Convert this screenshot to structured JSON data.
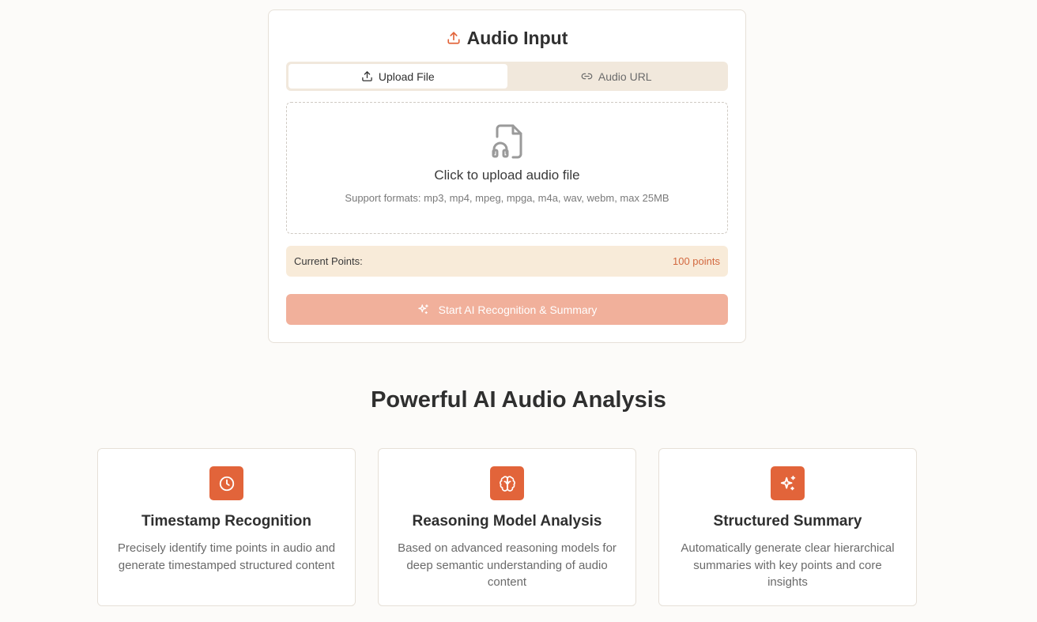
{
  "audio_input": {
    "title": "Audio Input",
    "tabs": [
      {
        "label": "Upload File",
        "active": true,
        "icon": "upload-icon"
      },
      {
        "label": "Audio URL",
        "active": false,
        "icon": "link-icon"
      }
    ],
    "dropzone": {
      "icon": "audio-file-icon",
      "title": "Click to upload audio file",
      "subtitle": "Support formats: mp3, mp4, mpeg, mpga, m4a, wav, webm, max 25MB"
    },
    "points": {
      "label": "Current Points:",
      "value": "100 points"
    },
    "start_button": {
      "label": "Start AI Recognition & Summary",
      "icon": "sparkles-icon",
      "disabled": true
    }
  },
  "features_section": {
    "title": "Powerful AI Audio Analysis",
    "features": [
      {
        "icon": "clock-icon",
        "title": "Timestamp Recognition",
        "description": "Precisely identify time points in audio and generate timestamped structured content"
      },
      {
        "icon": "brain-icon",
        "title": "Reasoning Model Analysis",
        "description": "Based on advanced reasoning models for deep semantic understanding of audio content"
      },
      {
        "icon": "sparkles-icon",
        "title": "Structured Summary",
        "description": "Automatically generate clear hierarchical summaries with key points and core insights"
      }
    ]
  },
  "colors": {
    "accent": "#e2643a",
    "button_disabled": "#f1b09b",
    "points_bg": "#f8ebd9",
    "tabs_bg": "#f1e8dc",
    "page_bg": "#fcfbf9"
  }
}
